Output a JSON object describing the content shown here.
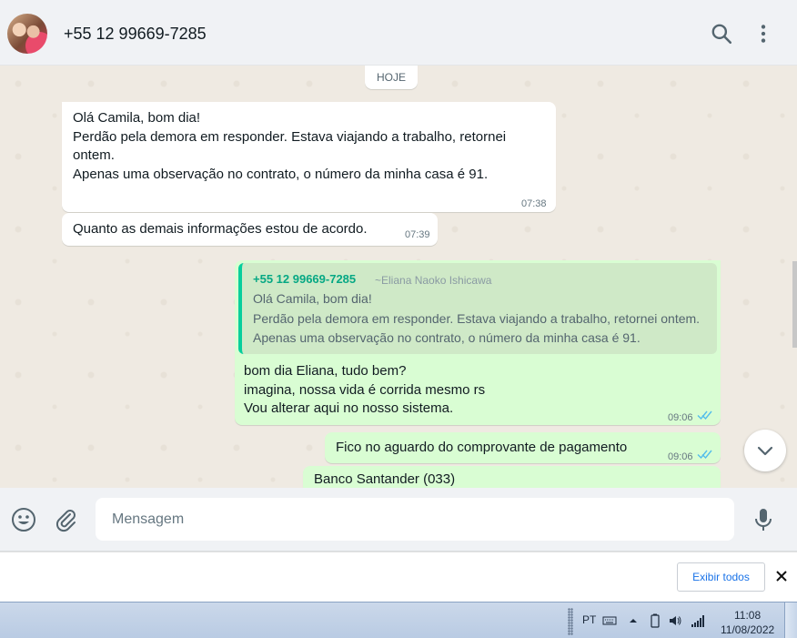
{
  "header": {
    "contact_name": "+55 12 99669-7285",
    "icons": [
      "avatar",
      "search-icon",
      "menu-icon"
    ]
  },
  "chat": {
    "date_chip": "HOJE",
    "messages": [
      {
        "direction": "incoming",
        "text": "Olá Camila, bom dia!\nPerdão pela demora em responder. Estava viajando a trabalho, retornei ontem.\nApenas uma observação no contrato, o número da minha casa é 91.",
        "time": "07:38"
      },
      {
        "direction": "incoming",
        "text": "Quanto as demais informações estou de acordo.",
        "time": "07:39"
      },
      {
        "direction": "outgoing",
        "quote": {
          "author": "+55 12 99669-7285",
          "push_name": "~Eliana Naoko Ishicawa",
          "text": "Olá Camila, bom dia!\nPerdão pela demora em responder. Estava viajando a trabalho, retornei ontem.\nApenas uma observação no contrato, o número da minha casa é 91."
        },
        "text": "bom dia Eliana, tudo bem?\nimagina, nossa vida é corrida mesmo rs\nVou alterar aqui no nosso sistema.",
        "time": "09:06",
        "status": "read"
      },
      {
        "direction": "outgoing",
        "text": "Fico no aguardo do comprovante de pagamento",
        "time": "09:06",
        "status": "read"
      },
      {
        "direction": "outgoing",
        "text": "Banco Santander (033)"
      }
    ]
  },
  "composer": {
    "placeholder": "Mensagem"
  },
  "download_bar": {
    "show_all_label": "Exibir todos"
  },
  "taskbar": {
    "language": "PT",
    "time": "11:08",
    "date": "11/08/2022"
  },
  "colors": {
    "incoming_bubble": "#ffffff",
    "outgoing_bubble": "#d9fdd3",
    "quote_accent": "#06cf9c",
    "read_ticks": "#53bdeb",
    "chat_background": "#efeae2"
  }
}
